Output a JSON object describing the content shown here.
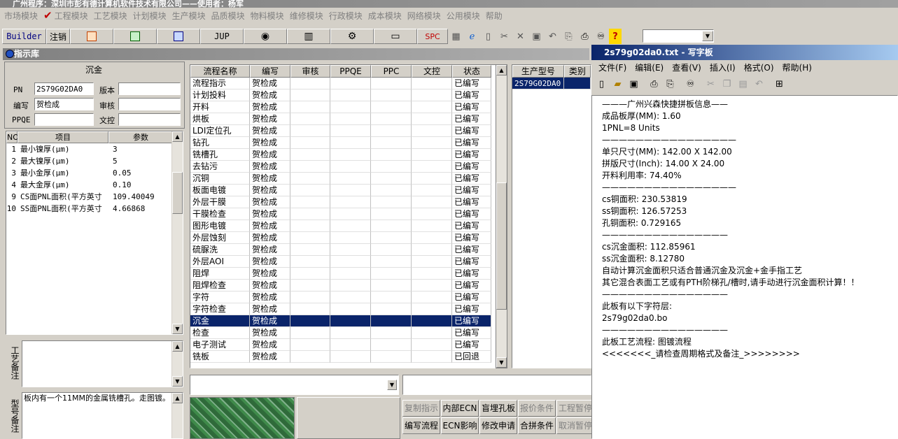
{
  "window": {
    "title": "广州程序：深圳市彭有德计算机软件技术有限公司——使用者：杨军"
  },
  "menu": [
    {
      "label": "市场模块",
      "checked": false
    },
    {
      "label": "工程模块",
      "checked": true
    },
    {
      "label": "工艺模块",
      "checked": false
    },
    {
      "label": "计划模块",
      "checked": false
    },
    {
      "label": "生产模块",
      "checked": false
    },
    {
      "label": "品质模块",
      "checked": false
    },
    {
      "label": "物料模块",
      "checked": false
    },
    {
      "label": "维修模块",
      "checked": false
    },
    {
      "label": "行政模块",
      "checked": false
    },
    {
      "label": "成本模块",
      "checked": false
    },
    {
      "label": "网络模块",
      "checked": false
    },
    {
      "label": "公用模块",
      "checked": false
    },
    {
      "label": "帮助",
      "checked": false
    }
  ],
  "toolbar": {
    "builder": "Builder",
    "logout": "注销",
    "jup": "JUP",
    "spc": "SPC"
  },
  "panel": {
    "title": "指示库"
  },
  "left": {
    "title": "沉金",
    "pn_label": "PN",
    "pn_value": "2S79G02DA0",
    "version_label": "版本",
    "version_value": "",
    "author_label": "编写",
    "author_value": "贺检成",
    "audit_label": "审核",
    "audit_value": "",
    "ppqe_label": "PPQE",
    "ppqe_value": "",
    "doc_label": "文控",
    "doc_value": "",
    "params_headers": [
      "NO",
      "项目",
      "参数"
    ],
    "params": [
      {
        "no": "1",
        "item": "最小镍厚(μm)",
        "value": "3"
      },
      {
        "no": "2",
        "item": "最大镍厚(μm)",
        "value": "5"
      },
      {
        "no": "3",
        "item": "最小金厚(μm)",
        "value": "0.05"
      },
      {
        "no": "4",
        "item": "最大金厚(μm)",
        "value": "0.10"
      },
      {
        "no": "9",
        "item": "CS面PNL面积(平方英寸",
        "value": "109.40049"
      },
      {
        "no": "10",
        "item": "SS面PNL面积(平方英寸",
        "value": "4.66868"
      }
    ],
    "craft_note_label": "工艺备注",
    "type_note_label": "型号备注",
    "type_note_text": "板内有一个11MM的金属铣槽孔。走图镀。"
  },
  "main": {
    "headers": [
      "流程名称",
      "编写",
      "审核",
      "PPQE",
      "PPC",
      "文控",
      "状态"
    ],
    "rows": [
      {
        "name": "流程指示",
        "author": "贺检成",
        "status": "已编写"
      },
      {
        "name": "计划投料",
        "author": "贺检成",
        "status": "已编写"
      },
      {
        "name": "开料",
        "author": "贺检成",
        "status": "已编写"
      },
      {
        "name": "烘板",
        "author": "贺检成",
        "status": "已编写"
      },
      {
        "name": "LDI定位孔",
        "author": "贺检成",
        "status": "已编写"
      },
      {
        "name": "钻孔",
        "author": "贺检成",
        "status": "已编写"
      },
      {
        "name": "铣槽孔",
        "author": "贺检成",
        "status": "已编写"
      },
      {
        "name": "去钻污",
        "author": "贺检成",
        "status": "已编写"
      },
      {
        "name": "沉铜",
        "author": "贺检成",
        "status": "已编写"
      },
      {
        "name": "板面电镀",
        "author": "贺检成",
        "status": "已编写"
      },
      {
        "name": "外层干膜",
        "author": "贺检成",
        "status": "已编写"
      },
      {
        "name": "干膜检查",
        "author": "贺检成",
        "status": "已编写"
      },
      {
        "name": "图形电镀",
        "author": "贺检成",
        "status": "已编写"
      },
      {
        "name": "外层蚀刻",
        "author": "贺检成",
        "status": "已编写"
      },
      {
        "name": "硫脲洗",
        "author": "贺检成",
        "status": "已编写"
      },
      {
        "name": "外层AOI",
        "author": "贺检成",
        "status": "已编写"
      },
      {
        "name": "阻焊",
        "author": "贺检成",
        "status": "已编写"
      },
      {
        "name": "阻焊检查",
        "author": "贺检成",
        "status": "已编写"
      },
      {
        "name": "字符",
        "author": "贺检成",
        "status": "已编写"
      },
      {
        "name": "字符检查",
        "author": "贺检成",
        "status": "已编写"
      },
      {
        "name": "沉金",
        "author": "贺检成",
        "status": "已编写",
        "selected": true
      },
      {
        "name": "检查",
        "author": "贺检成",
        "status": "已编写"
      },
      {
        "name": "电子测试",
        "author": "贺检成",
        "status": "已编写"
      },
      {
        "name": "铣板",
        "author": "贺检成",
        "status": "已回退"
      }
    ]
  },
  "product": {
    "headers": [
      "生产型号",
      "类别"
    ],
    "rows": [
      {
        "model": "2S79G02DA0"
      }
    ]
  },
  "actions": {
    "row1": [
      "复制指示",
      "内部ECN",
      "盲埋孔板",
      "报价条件",
      "工程暂停"
    ],
    "row2": [
      "编写流程",
      "ECN影响",
      "修改申请",
      "合拼条件",
      "取消暂停"
    ]
  },
  "notepad": {
    "title": "2s79g02da0.txt - 写字板",
    "menu": [
      "文件(F)",
      "编辑(E)",
      "查看(V)",
      "插入(I)",
      "格式(O)",
      "帮助(H)"
    ],
    "lines": [
      "———广州兴森快捷拼板信息——",
      "成品板厚(MM): 1.60",
      "1PNL=8 Units",
      "————————————————",
      "单只尺寸(MM): 142.00 X 142.00",
      "拼版尺寸(Inch): 14.00 X 24.00",
      "开料利用率: 74.40%",
      "————————————————",
      "cs铜面积: 230.53819",
      "ss铜面积: 126.57253",
      "孔铜面积: 0.729165",
      "———————————————",
      "cs沉金面积: 112.85961",
      "ss沉金面积: 8.12780",
      "自动计算沉金面积只适合普通沉金及沉金+金手指工艺",
      "其它混合表面工艺或有PTH阶梯孔/槽时,请手动进行沉金面积计算！！",
      "———————————————",
      "此板有以下字符层:",
      "2s79g02da0.bo",
      "———————————————",
      "此板工艺流程: 图镀流程",
      "<<<<<<<_请检查周期格式及备注_>>>>>>>>"
    ]
  },
  "colors": {
    "selection": "#0a246a",
    "title_active": "#0a246a",
    "disabled_text": "#808080"
  }
}
